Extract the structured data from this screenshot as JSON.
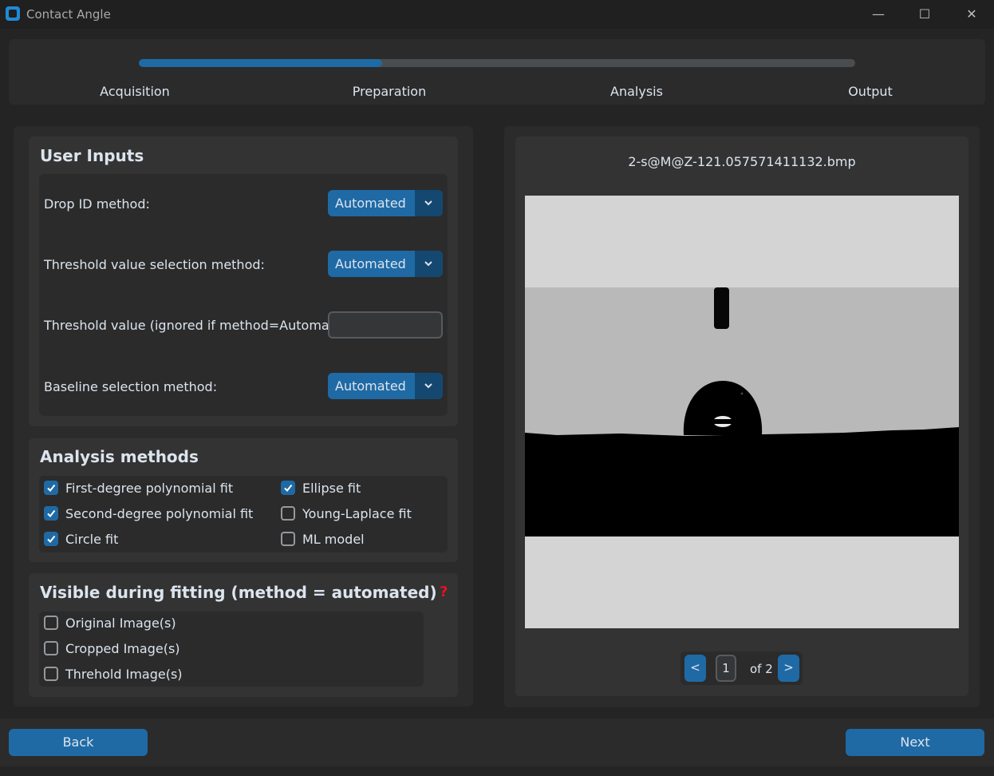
{
  "window": {
    "title": "Contact Angle",
    "minimize_glyph": "—",
    "maximize_glyph": "☐",
    "close_glyph": "✕"
  },
  "progress": {
    "value": 0.34,
    "steps": [
      "Acquisition",
      "Preparation",
      "Analysis",
      "Output"
    ]
  },
  "user_inputs": {
    "title": "User Inputs",
    "drop_id_label": "Drop ID method:",
    "drop_id_value": "Automated",
    "threshold_method_label": "Threshold value selection method:",
    "threshold_method_value": "Automated",
    "threshold_value_label": "Threshold value (ignored if method=Automated):",
    "threshold_value": "",
    "baseline_label": "Baseline selection method:",
    "baseline_value": "Automated"
  },
  "analysis_methods": {
    "title": "Analysis methods",
    "items": [
      {
        "label": "First-degree polynomial fit",
        "checked": true
      },
      {
        "label": "Ellipse fit",
        "checked": true
      },
      {
        "label": "Second-degree polynomial fit",
        "checked": true
      },
      {
        "label": "Young-Laplace fit",
        "checked": false
      },
      {
        "label": "Circle fit",
        "checked": true
      },
      {
        "label": "ML model",
        "checked": false
      }
    ]
  },
  "visible_fitting": {
    "title": "Visible during fitting (method = automated)",
    "help_glyph": "?",
    "items": [
      {
        "label": "Original Image(s)",
        "checked": false
      },
      {
        "label": "Cropped Image(s)",
        "checked": false
      },
      {
        "label": "Threhold Image(s)",
        "checked": false
      }
    ]
  },
  "preview": {
    "filename": "2-s@M@Z-121.057571411132.bmp",
    "prev_label": "<",
    "page": "1",
    "of_label": "of 2",
    "next_label": ">"
  },
  "nav": {
    "back_label": "Back",
    "next_label": "Next"
  },
  "colors": {
    "accent": "#1f6aa5",
    "accent_dark": "#144870",
    "help": "#e81123"
  }
}
